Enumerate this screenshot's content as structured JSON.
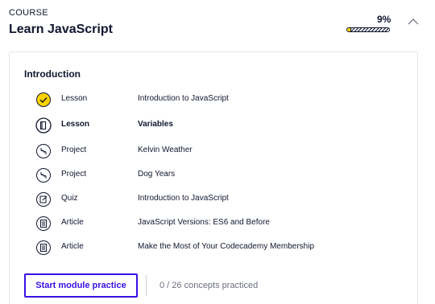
{
  "header": {
    "course_label": "COURSE",
    "course_title": "Learn JavaScript",
    "progress_text": "9%",
    "progress_fraction": 0.09,
    "progress_color": "#ffd300",
    "collapse_icon": "chevron-up-icon"
  },
  "module": {
    "title": "Introduction",
    "items": [
      {
        "type": "Lesson",
        "name": "Introduction to JavaScript",
        "icon": "check-circle-icon",
        "status": "completed"
      },
      {
        "type": "Lesson",
        "name": "Variables",
        "icon": "book-icon",
        "status": "current"
      },
      {
        "type": "Project",
        "name": "Kelvin Weather",
        "icon": "project-icon",
        "status": "todo"
      },
      {
        "type": "Project",
        "name": "Dog Years",
        "icon": "project-icon",
        "status": "todo"
      },
      {
        "type": "Quiz",
        "name": "Introduction to JavaScript",
        "icon": "quiz-icon",
        "status": "todo"
      },
      {
        "type": "Article",
        "name": "JavaScript Versions: ES6 and Before",
        "icon": "article-icon",
        "status": "todo"
      },
      {
        "type": "Article",
        "name": "Make the Most of Your Codecademy Membership",
        "icon": "article-icon",
        "status": "todo"
      }
    ],
    "practice_button": "Start module practice",
    "concepts_text": "0 / 26 concepts practiced"
  },
  "colors": {
    "accent": "#3a10e5",
    "text": "#10162f",
    "completed": "#ffd300",
    "muted": "#6b6f80"
  }
}
